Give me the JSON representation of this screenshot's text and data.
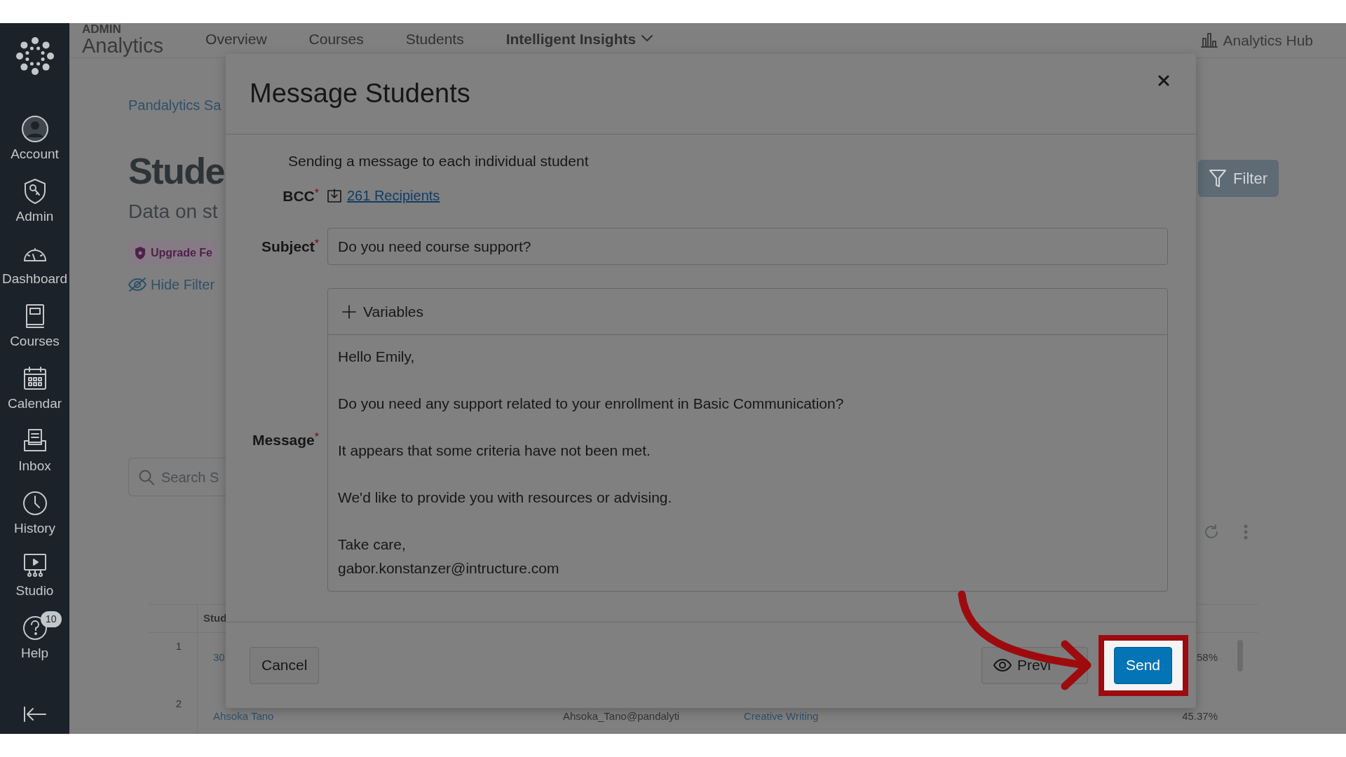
{
  "sidebar": {
    "items": [
      {
        "kind": "account",
        "label": "Account"
      },
      {
        "kind": "admin",
        "label": "Admin"
      },
      {
        "kind": "dashboard",
        "label": "Dashboard"
      },
      {
        "kind": "courses",
        "label": "Courses"
      },
      {
        "kind": "calendar",
        "label": "Calendar"
      },
      {
        "kind": "inbox",
        "label": "Inbox"
      },
      {
        "kind": "history",
        "label": "History"
      },
      {
        "kind": "studio",
        "label": "Studio"
      },
      {
        "kind": "help",
        "label": "Help",
        "badge": "10"
      }
    ]
  },
  "header": {
    "eyebrow": "ADMIN",
    "title": "Analytics",
    "nav": [
      {
        "label": "Overview",
        "selected": false,
        "dropdown": false
      },
      {
        "label": "Courses",
        "selected": false,
        "dropdown": false
      },
      {
        "label": "Students",
        "selected": false,
        "dropdown": false
      },
      {
        "label": "Intelligent Insights",
        "selected": true,
        "dropdown": true
      }
    ],
    "hub_link": "Analytics Hub"
  },
  "page": {
    "breadcrumb": "Pandalytics Sa",
    "heading": "Stude",
    "subheading": "Data on st",
    "upgrade_badge": "Upgrade Fe",
    "hide_filters": "Hide Filter",
    "search_placeholder": "Search S",
    "filter_button": "Filter"
  },
  "table": {
    "columns": [
      "Stud"
    ],
    "rows": [
      {
        "index": "1",
        "name": "30",
        "score": ".58%"
      },
      {
        "index": "2",
        "name": "Ahsoka Tano",
        "email": "Ahsoka_Tano@pandalyti",
        "course": "Creative Writing",
        "score": "45.37%"
      }
    ]
  },
  "modal": {
    "title": "Message Students",
    "intro": "Sending a message to each individual student",
    "bcc": {
      "label": "BCC",
      "required_mark": "*",
      "link": "261 Recipients"
    },
    "subject": {
      "label": "Subject",
      "required_mark": "*",
      "value": "Do you need course support?"
    },
    "message": {
      "label": "Message",
      "required_mark": "*",
      "toolbar": "Variables",
      "paragraphs": [
        [
          "Hello Emily,"
        ],
        [
          "Do you need any support related to your enrollment in Basic Communication?"
        ],
        [
          "It appears that some criteria have not been met."
        ],
        [
          "We'd like to provide you with resources or advising."
        ],
        [
          "Take care,",
          "gabor.konstanzer@intructure.com"
        ]
      ]
    },
    "buttons": [
      {
        "kind": "secondary",
        "label": "Cancel",
        "highlighted": false
      },
      {
        "kind": "preview",
        "label": "Previ",
        "highlighted": false
      },
      {
        "kind": "primary",
        "label": "Send",
        "highlighted": true
      }
    ]
  }
}
